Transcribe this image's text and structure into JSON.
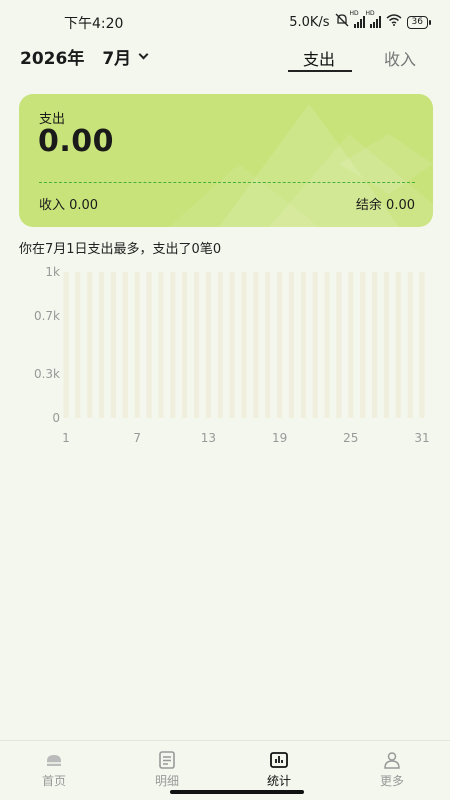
{
  "status_bar": {
    "time": "下午4:20",
    "net_speed": "5.0K/s",
    "battery": "36"
  },
  "header": {
    "year": "2026年",
    "month": "7月",
    "tabs": [
      {
        "label": "支出",
        "active": true
      },
      {
        "label": "收入",
        "active": false
      }
    ]
  },
  "summary": {
    "label": "支出",
    "amount": "0.00",
    "income": "收入 0.00",
    "balance": "结余 0.00",
    "card_color": "#c8e37a"
  },
  "max_info": "你在7月1日支出最多，支出了0笔0",
  "chart_data": {
    "type": "bar",
    "title": "",
    "xlabel": "",
    "ylabel": "",
    "x_tick_labels": [
      "1",
      "7",
      "13",
      "19",
      "25",
      "31"
    ],
    "y_tick_labels": [
      "0",
      "0.3k",
      "0.7k",
      "1k"
    ],
    "ylim": [
      0,
      1000
    ],
    "categories": [
      "1",
      "2",
      "3",
      "4",
      "5",
      "6",
      "7",
      "8",
      "9",
      "10",
      "11",
      "12",
      "13",
      "14",
      "15",
      "16",
      "17",
      "18",
      "19",
      "20",
      "21",
      "22",
      "23",
      "24",
      "25",
      "26",
      "27",
      "28",
      "29",
      "30",
      "31"
    ],
    "values": [
      0,
      0,
      0,
      0,
      0,
      0,
      0,
      0,
      0,
      0,
      0,
      0,
      0,
      0,
      0,
      0,
      0,
      0,
      0,
      0,
      0,
      0,
      0,
      0,
      0,
      0,
      0,
      0,
      0,
      0,
      0
    ],
    "background_bar_color": "#f0eedc",
    "grid": false
  },
  "tab_bar": {
    "items": [
      {
        "label": "首页",
        "icon": "home-icon",
        "active": false
      },
      {
        "label": "明细",
        "icon": "list-icon",
        "active": false
      },
      {
        "label": "统计",
        "icon": "stats-icon",
        "active": true
      },
      {
        "label": "更多",
        "icon": "profile-icon",
        "active": false
      }
    ]
  }
}
